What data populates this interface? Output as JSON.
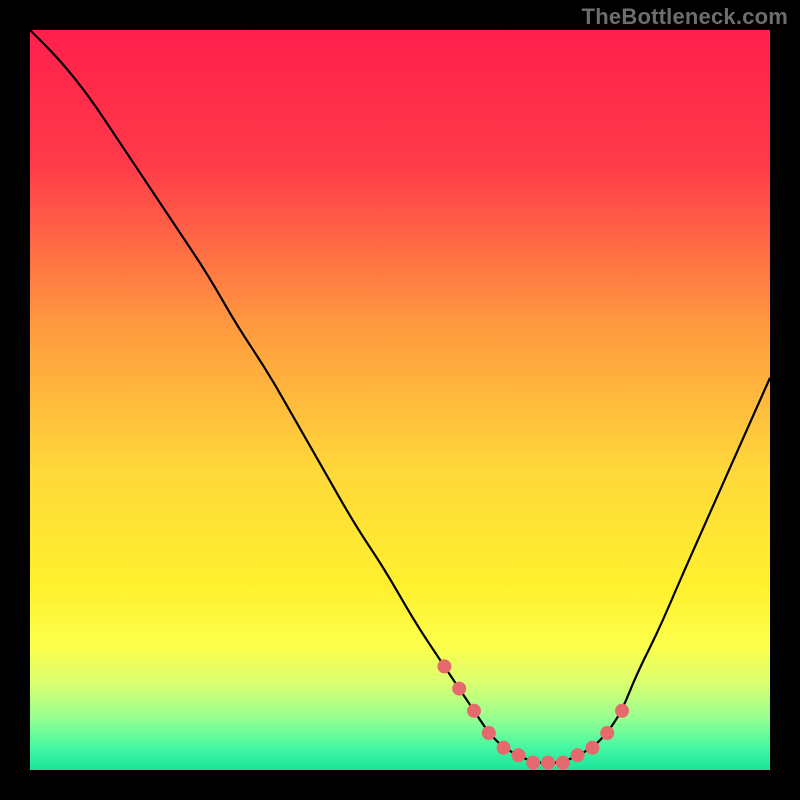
{
  "watermark": "TheBottleneck.com",
  "chart_data": {
    "type": "line",
    "title": "",
    "xlabel": "",
    "ylabel": "",
    "xlim": [
      0,
      100
    ],
    "ylim": [
      0,
      100
    ],
    "background_gradient": {
      "stops": [
        {
          "offset": 0.0,
          "color": "#ff1f4b"
        },
        {
          "offset": 0.18,
          "color": "#ff3a4a"
        },
        {
          "offset": 0.4,
          "color": "#ff9a3f"
        },
        {
          "offset": 0.6,
          "color": "#ffd93a"
        },
        {
          "offset": 0.75,
          "color": "#fff02e"
        },
        {
          "offset": 0.83,
          "color": "#fdff4a"
        },
        {
          "offset": 0.88,
          "color": "#dcff6e"
        },
        {
          "offset": 0.93,
          "color": "#96ff90"
        },
        {
          "offset": 0.97,
          "color": "#44f7a2"
        },
        {
          "offset": 1.0,
          "color": "#19e59a"
        }
      ]
    },
    "series": [
      {
        "name": "bottleneck-curve",
        "x": [
          0,
          4,
          8,
          12,
          16,
          20,
          24,
          28,
          32,
          36,
          40,
          44,
          48,
          52,
          56,
          58,
          60,
          62,
          64,
          66,
          68,
          70,
          72,
          74,
          76,
          78,
          80,
          82,
          85,
          88,
          92,
          96,
          100
        ],
        "y": [
          100,
          96,
          91,
          85,
          79,
          73,
          67,
          60,
          54,
          47,
          40,
          33,
          27,
          20,
          14,
          11,
          8,
          5,
          3,
          2,
          1,
          1,
          1,
          2,
          3,
          5,
          8,
          13,
          19,
          26,
          35,
          44,
          53
        ]
      }
    ],
    "points": {
      "name": "highlight-dots",
      "x": [
        56,
        58,
        60,
        62,
        64,
        66,
        68,
        70,
        72,
        74,
        76,
        78,
        80
      ],
      "y": [
        14,
        11,
        8,
        5,
        3,
        2,
        1,
        1,
        1,
        2,
        3,
        5,
        8,
        13
      ],
      "color": "#e66a6d",
      "radius": 7
    }
  }
}
